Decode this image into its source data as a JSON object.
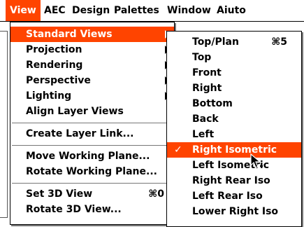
{
  "menubar": {
    "items": [
      {
        "label": "View"
      },
      {
        "label": "AEC"
      },
      {
        "label": "Design"
      },
      {
        "label": "Palettes"
      },
      {
        "label": "Window"
      },
      {
        "label": "Aiuto"
      }
    ]
  },
  "view_menu": {
    "items": [
      {
        "label": "Standard Views"
      },
      {
        "label": "Projection"
      },
      {
        "label": "Rendering"
      },
      {
        "label": "Perspective"
      },
      {
        "label": "Lighting"
      },
      {
        "label": "Align Layer Views"
      },
      {
        "label": "Create Layer Link..."
      },
      {
        "label": "Move Working Plane..."
      },
      {
        "label": "Rotate Working Plane..."
      },
      {
        "label": "Set 3D View",
        "shortcut": "⌘0"
      },
      {
        "label": "Rotate 3D View..."
      }
    ]
  },
  "standard_views_menu": {
    "items": [
      {
        "label": "Top/Plan",
        "shortcut": "⌘5"
      },
      {
        "label": "Top"
      },
      {
        "label": "Front"
      },
      {
        "label": "Right"
      },
      {
        "label": "Bottom"
      },
      {
        "label": "Back"
      },
      {
        "label": "Left"
      },
      {
        "label": "Right Isometric",
        "check": "✓"
      },
      {
        "label": "Left Isometric"
      },
      {
        "label": "Right Rear Iso"
      },
      {
        "label": "Left Rear Iso"
      },
      {
        "label": "Lower Right Iso"
      }
    ]
  },
  "colors": {
    "highlight": "#ff4400"
  }
}
